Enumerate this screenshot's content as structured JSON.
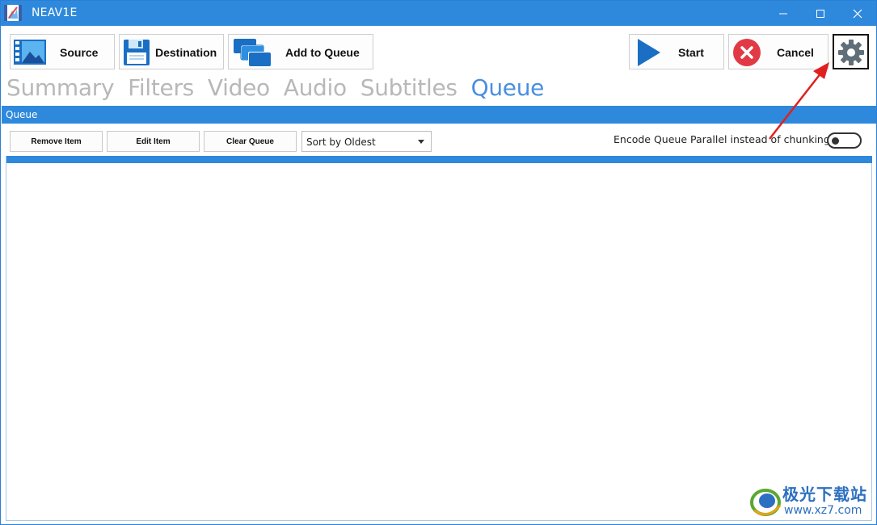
{
  "window": {
    "title": "NEAV1E"
  },
  "toolbar": {
    "source_label": "Source",
    "destination_label": "Destination",
    "add_to_queue_label": "Add to Queue",
    "start_label": "Start",
    "cancel_label": "Cancel"
  },
  "tabs": [
    "Summary",
    "Filters",
    "Video",
    "Audio",
    "Subtitles",
    "Queue"
  ],
  "active_tab": "Queue",
  "section": {
    "title": "Queue"
  },
  "queue_controls": {
    "remove_item": "Remove Item",
    "edit_item": "Edit Item",
    "clear_queue": "Clear Queue",
    "sort_selected": "Sort by Oldest",
    "parallel_label": "Encode Queue Parallel instead of chunking:",
    "parallel_enabled": false
  },
  "watermark": {
    "text": "极光下载站",
    "url": "www.xz7.com"
  },
  "colors": {
    "accent": "#2e89dc",
    "active_tab": "#4a8fe0",
    "inactive_tab": "#b8b8b8",
    "arrow": "#e02020"
  }
}
